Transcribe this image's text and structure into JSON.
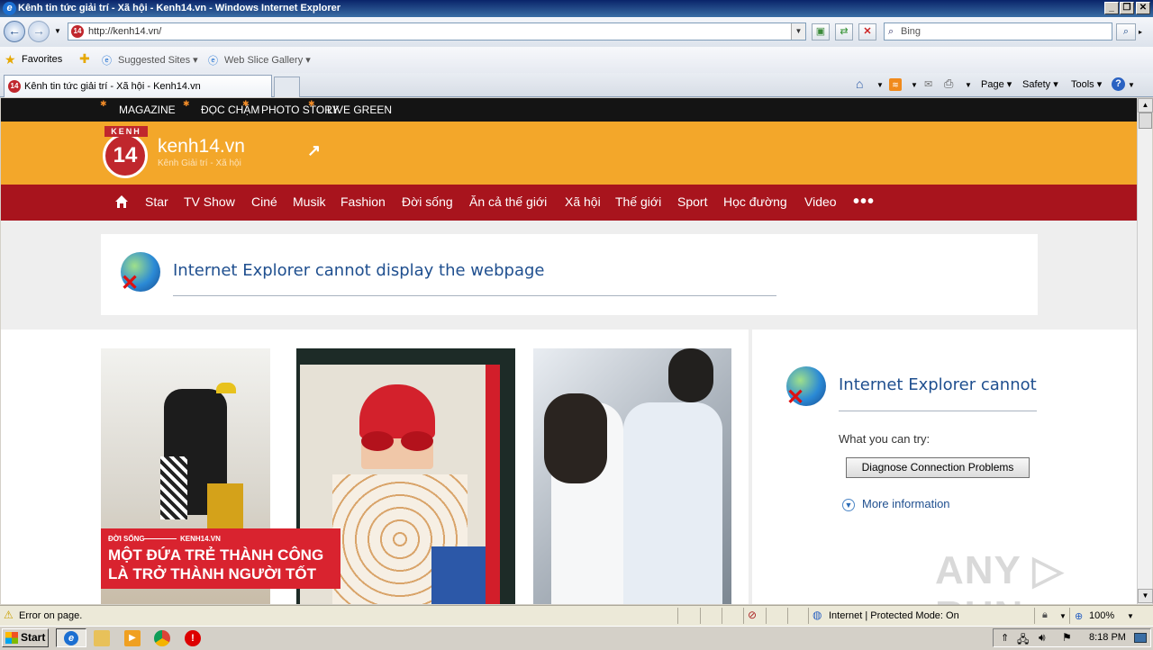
{
  "window": {
    "title": "Kênh tin tức giải trí - Xã hội - Kenh14.vn - Windows Internet Explorer",
    "min": "_",
    "max": "❐",
    "close": "✕"
  },
  "nav": {
    "address": "http://kenh14.vn/",
    "search_placeholder": "Bing"
  },
  "favbar": {
    "favorites": "Favorites",
    "suggested": "Suggested Sites ▾",
    "webslice": "Web Slice Gallery ▾"
  },
  "tabs": {
    "active": "Kênh tin tức giải trí - Xã hội - Kenh14.vn"
  },
  "commandbar": {
    "page": "Page ▾",
    "safety": "Safety ▾",
    "tools": "Tools ▾",
    "help": "?"
  },
  "site": {
    "topnav": [
      "MAGAZINE",
      "ĐỌC CHẬM",
      "PHOTO STORY",
      "LIVE GREEN"
    ],
    "logo_kenh": "KENH",
    "logo_num": "14",
    "name": "kenh14.vn",
    "subtitle": "Kênh Giải trí - Xã hội",
    "categories": [
      "Star",
      "TV Show",
      "Ciné",
      "Musik",
      "Fashion",
      "Đời sống",
      "Ăn cả thế giới",
      "Xã hội",
      "Thế giới",
      "Sport",
      "Học đường",
      "Video"
    ],
    "more": "•••"
  },
  "error1": {
    "title": "Internet Explorer cannot display the webpage"
  },
  "caption": {
    "section": "ĐỜI SỐNG",
    "site": "KENH14.VN",
    "line1": "MỘT ĐỨA TRẺ THÀNH CÔNG",
    "line2": "LÀ TRỞ THÀNH NGƯỜI TỐT"
  },
  "error2": {
    "title": "Internet Explorer cannot disp",
    "try": "What you can try:",
    "button": "Diagnose Connection Problems",
    "more": "More information"
  },
  "watermark": "ANY ▷ RUN",
  "statusbar": {
    "left": "Error on page.",
    "zone": "Internet | Protected Mode: On",
    "zoom": "100%"
  },
  "taskbar": {
    "start": "Start",
    "time": "8:18 PM"
  }
}
